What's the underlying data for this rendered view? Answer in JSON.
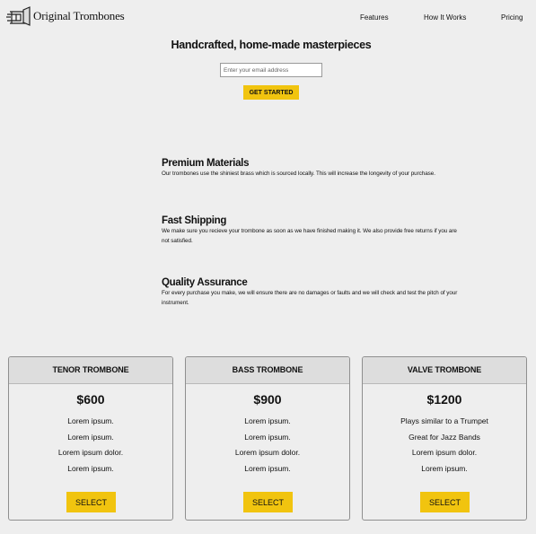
{
  "header": {
    "brand": "Original Trombones",
    "nav": [
      {
        "label": "Features"
      },
      {
        "label": "How It Works"
      },
      {
        "label": "Pricing"
      }
    ]
  },
  "hero": {
    "title": "Handcrafted, home-made masterpieces",
    "email_placeholder": "Enter your email address",
    "email_value": "",
    "cta_label": "GET STARTED"
  },
  "features": [
    {
      "title": "Premium Materials",
      "text": "Our trombones use the shiniest brass which is sourced locally. This will increase the longevity of your purchase."
    },
    {
      "title": "Fast Shipping",
      "text": "We make sure you recieve your trombone as soon as we have finished making it. We also provide free returns if you are not satisfied."
    },
    {
      "title": "Quality Assurance",
      "text": "For every purchase you make, we will ensure there are no damages or faults and we will check and test the pitch of your instrument."
    }
  ],
  "pricing": [
    {
      "name": "TENOR TROMBONE",
      "price": "$600",
      "features": [
        "Lorem ipsum.",
        "Lorem ipsum.",
        "Lorem ipsum dolor.",
        "Lorem ipsum."
      ],
      "button": "SELECT"
    },
    {
      "name": "BASS TROMBONE",
      "price": "$900",
      "features": [
        "Lorem ipsum.",
        "Lorem ipsum.",
        "Lorem ipsum dolor.",
        "Lorem ipsum."
      ],
      "button": "SELECT"
    },
    {
      "name": "VALVE TROMBONE",
      "price": "$1200",
      "features": [
        "Plays similar to a Trumpet",
        "Great for Jazz Bands",
        "Lorem ipsum dolor.",
        "Lorem ipsum."
      ],
      "button": "SELECT"
    }
  ],
  "colors": {
    "accent": "#f1c40f",
    "background": "#eeeeee",
    "card_header": "#dddddd"
  },
  "icons": {
    "logo": "trombone-icon"
  }
}
